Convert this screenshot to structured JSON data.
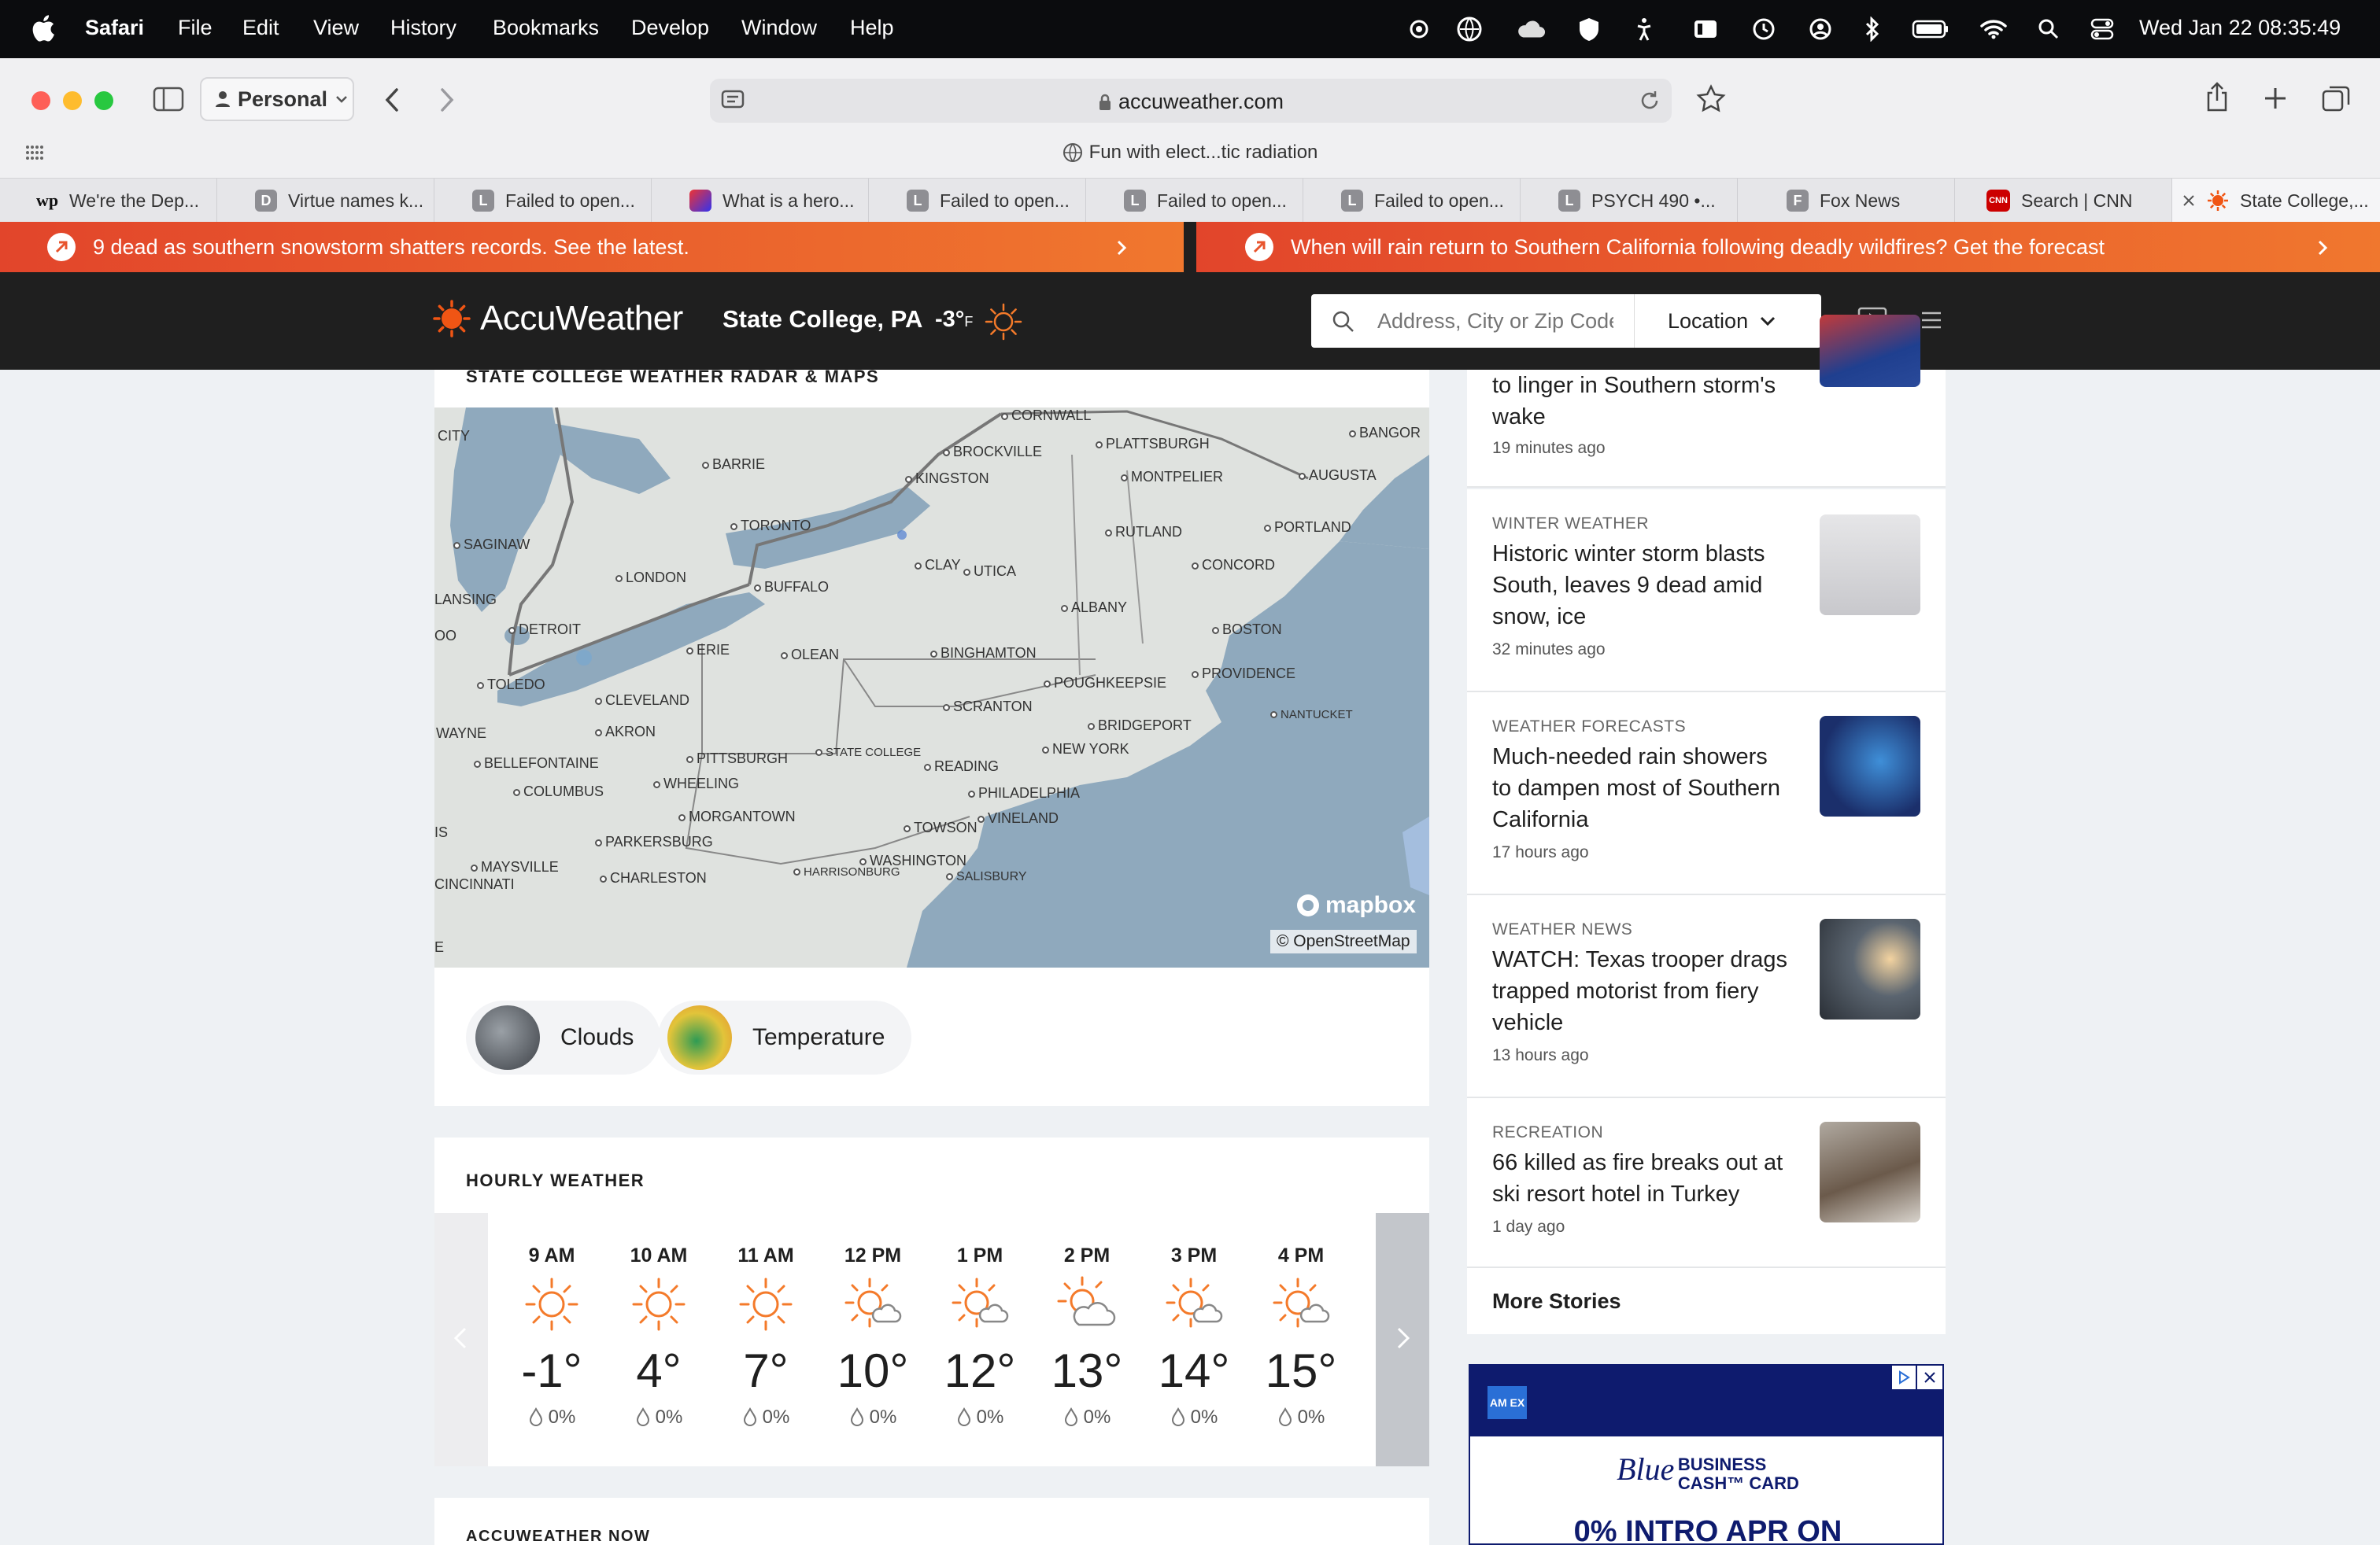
{
  "menubar": {
    "app": "Safari",
    "items": [
      "File",
      "Edit",
      "View",
      "History",
      "Bookmarks",
      "Develop",
      "Window",
      "Help"
    ],
    "datetime": "Wed Jan 22  08:35:49",
    "status_icons": [
      "creative-cloud-icon",
      "vpn-globe-icon",
      "icloud-icon",
      "shield-icon",
      "accessibility-icon",
      "stage-manager-icon",
      "time-machine-icon",
      "user-icon",
      "bluetooth-icon",
      "battery-icon",
      "wifi-icon",
      "spotlight-icon",
      "control-center-icon"
    ]
  },
  "browser": {
    "profile": "Personal",
    "url": "accuweather.com",
    "page_subtitle": "Fun with elect...tic radiation",
    "tabs": [
      {
        "label": "We're the Dep...",
        "fav": "wp"
      },
      {
        "label": "Virtue names k...",
        "fav": "D"
      },
      {
        "label": "Failed to open...",
        "fav": "L"
      },
      {
        "label": "What is a hero...",
        "fav": "~"
      },
      {
        "label": "Failed to open...",
        "fav": "L"
      },
      {
        "label": "Failed to open...",
        "fav": "L"
      },
      {
        "label": "Failed to open...",
        "fav": "L"
      },
      {
        "label": "PSYCH 490 •...",
        "fav": "L"
      },
      {
        "label": "Fox News",
        "fav": "F"
      },
      {
        "label": "Search | CNN",
        "fav": "CNN"
      },
      {
        "label": "State College,...",
        "fav": "aw"
      }
    ]
  },
  "banners": [
    {
      "text": "9 dead as southern snowstorm shatters records. See the latest."
    },
    {
      "text": "When will rain return to Southern California following deadly wildfires? Get the forecast"
    }
  ],
  "header": {
    "logo": "AccuWeather",
    "location": "State College, PA",
    "temp": "-3°",
    "temp_unit": "F",
    "search_placeholder": "Address, City or Zip Code",
    "location_button": "Location"
  },
  "radar": {
    "title": "STATE COLLEGE WEATHER RADAR & MAPS",
    "attribution_brand": "mapbox",
    "attribution": "© OpenStreetMap",
    "cities": [
      "CITY",
      "CORNWALL",
      "PLATTSBURGH",
      "BANGOR",
      "BROCKVILLE",
      "BARRIE",
      "KINGSTON",
      "MONTPELIER",
      "AUGUSTA",
      "SAGINAW",
      "TORONTO",
      "RUTLAND",
      "PORTLAND",
      "CLAY",
      "UTICA",
      "CONCORD",
      "LONDON",
      "BUFFALO",
      "LANSING",
      "ALBANY",
      "DETROIT",
      "BOSTON",
      "ERIE",
      "OLEAN",
      "BINGHAMTON",
      "PROVIDENCE",
      "TOLEDO",
      "POUGHKEEPSIE",
      "CLEVELAND",
      "SCRANTON",
      "NANTUCKET",
      "WAYNE",
      "AKRON",
      "BRIDGEPORT",
      "STATE COLLEGE",
      "NEW YORK",
      "BELLEFONTAINE",
      "PITTSBURGH",
      "READING",
      "COLUMBUS",
      "WHEELING",
      "PHILADELPHIA",
      "MORGANTOWN",
      "TOWSON",
      "VINELAND",
      "CINCINNATI",
      "PARKERSBURG",
      "WASHINGTON",
      "MAYSVILLE",
      "CHARLESTON",
      "HARRISONBURG",
      "SALISBURY",
      "OO",
      "IS",
      "E"
    ],
    "layers": [
      "Clouds",
      "Temperature"
    ]
  },
  "hourly": {
    "title": "HOURLY WEATHER",
    "hours": [
      {
        "time": "9 AM",
        "temp": "-1°",
        "precip": "0%",
        "icon": "sunny-icon"
      },
      {
        "time": "10 AM",
        "temp": "4°",
        "precip": "0%",
        "icon": "sunny-icon"
      },
      {
        "time": "11 AM",
        "temp": "7°",
        "precip": "0%",
        "icon": "sunny-icon"
      },
      {
        "time": "12 PM",
        "temp": "10°",
        "precip": "0%",
        "icon": "mostly-sunny-icon"
      },
      {
        "time": "1 PM",
        "temp": "12°",
        "precip": "0%",
        "icon": "mostly-sunny-icon"
      },
      {
        "time": "2 PM",
        "temp": "13°",
        "precip": "0%",
        "icon": "partly-sunny-icon"
      },
      {
        "time": "3 PM",
        "temp": "14°",
        "precip": "0%",
        "icon": "mostly-sunny-icon"
      },
      {
        "time": "4 PM",
        "temp": "15°",
        "precip": "0%",
        "icon": "mostly-sunny-icon"
      }
    ]
  },
  "now": {
    "title": "ACCUWEATHER NOW"
  },
  "news": {
    "top_partial": {
      "headline": "to linger in Southern storm's wake",
      "time": "19 minutes ago"
    },
    "items": [
      {
        "category": "WINTER WEATHER",
        "headline": "Historic winter storm blasts South, leaves 9 dead amid snow, ice",
        "time": "32 minutes ago"
      },
      {
        "category": "WEATHER FORECASTS",
        "headline": "Much-needed rain showers to dampen most of Southern California",
        "time": "17 hours ago"
      },
      {
        "category": "WEATHER NEWS",
        "headline": "WATCH: Texas trooper drags trapped motorist from fiery vehicle",
        "time": "13 hours ago"
      },
      {
        "category": "RECREATION",
        "headline": "66 killed as fire breaks out at ski resort hotel in Turkey",
        "time": "1 day ago"
      }
    ],
    "more": "More Stories"
  },
  "ad": {
    "brand": "AM EX",
    "product_line1": "Blue",
    "product_line2": "BUSINESS",
    "product_line3": "CASH™ CARD",
    "headline": "0% INTRO APR ON"
  },
  "colors": {
    "accent": "#f05514",
    "banner": "#e8542d",
    "header": "#1f1f1f",
    "map_water": "#8fa9bd"
  }
}
